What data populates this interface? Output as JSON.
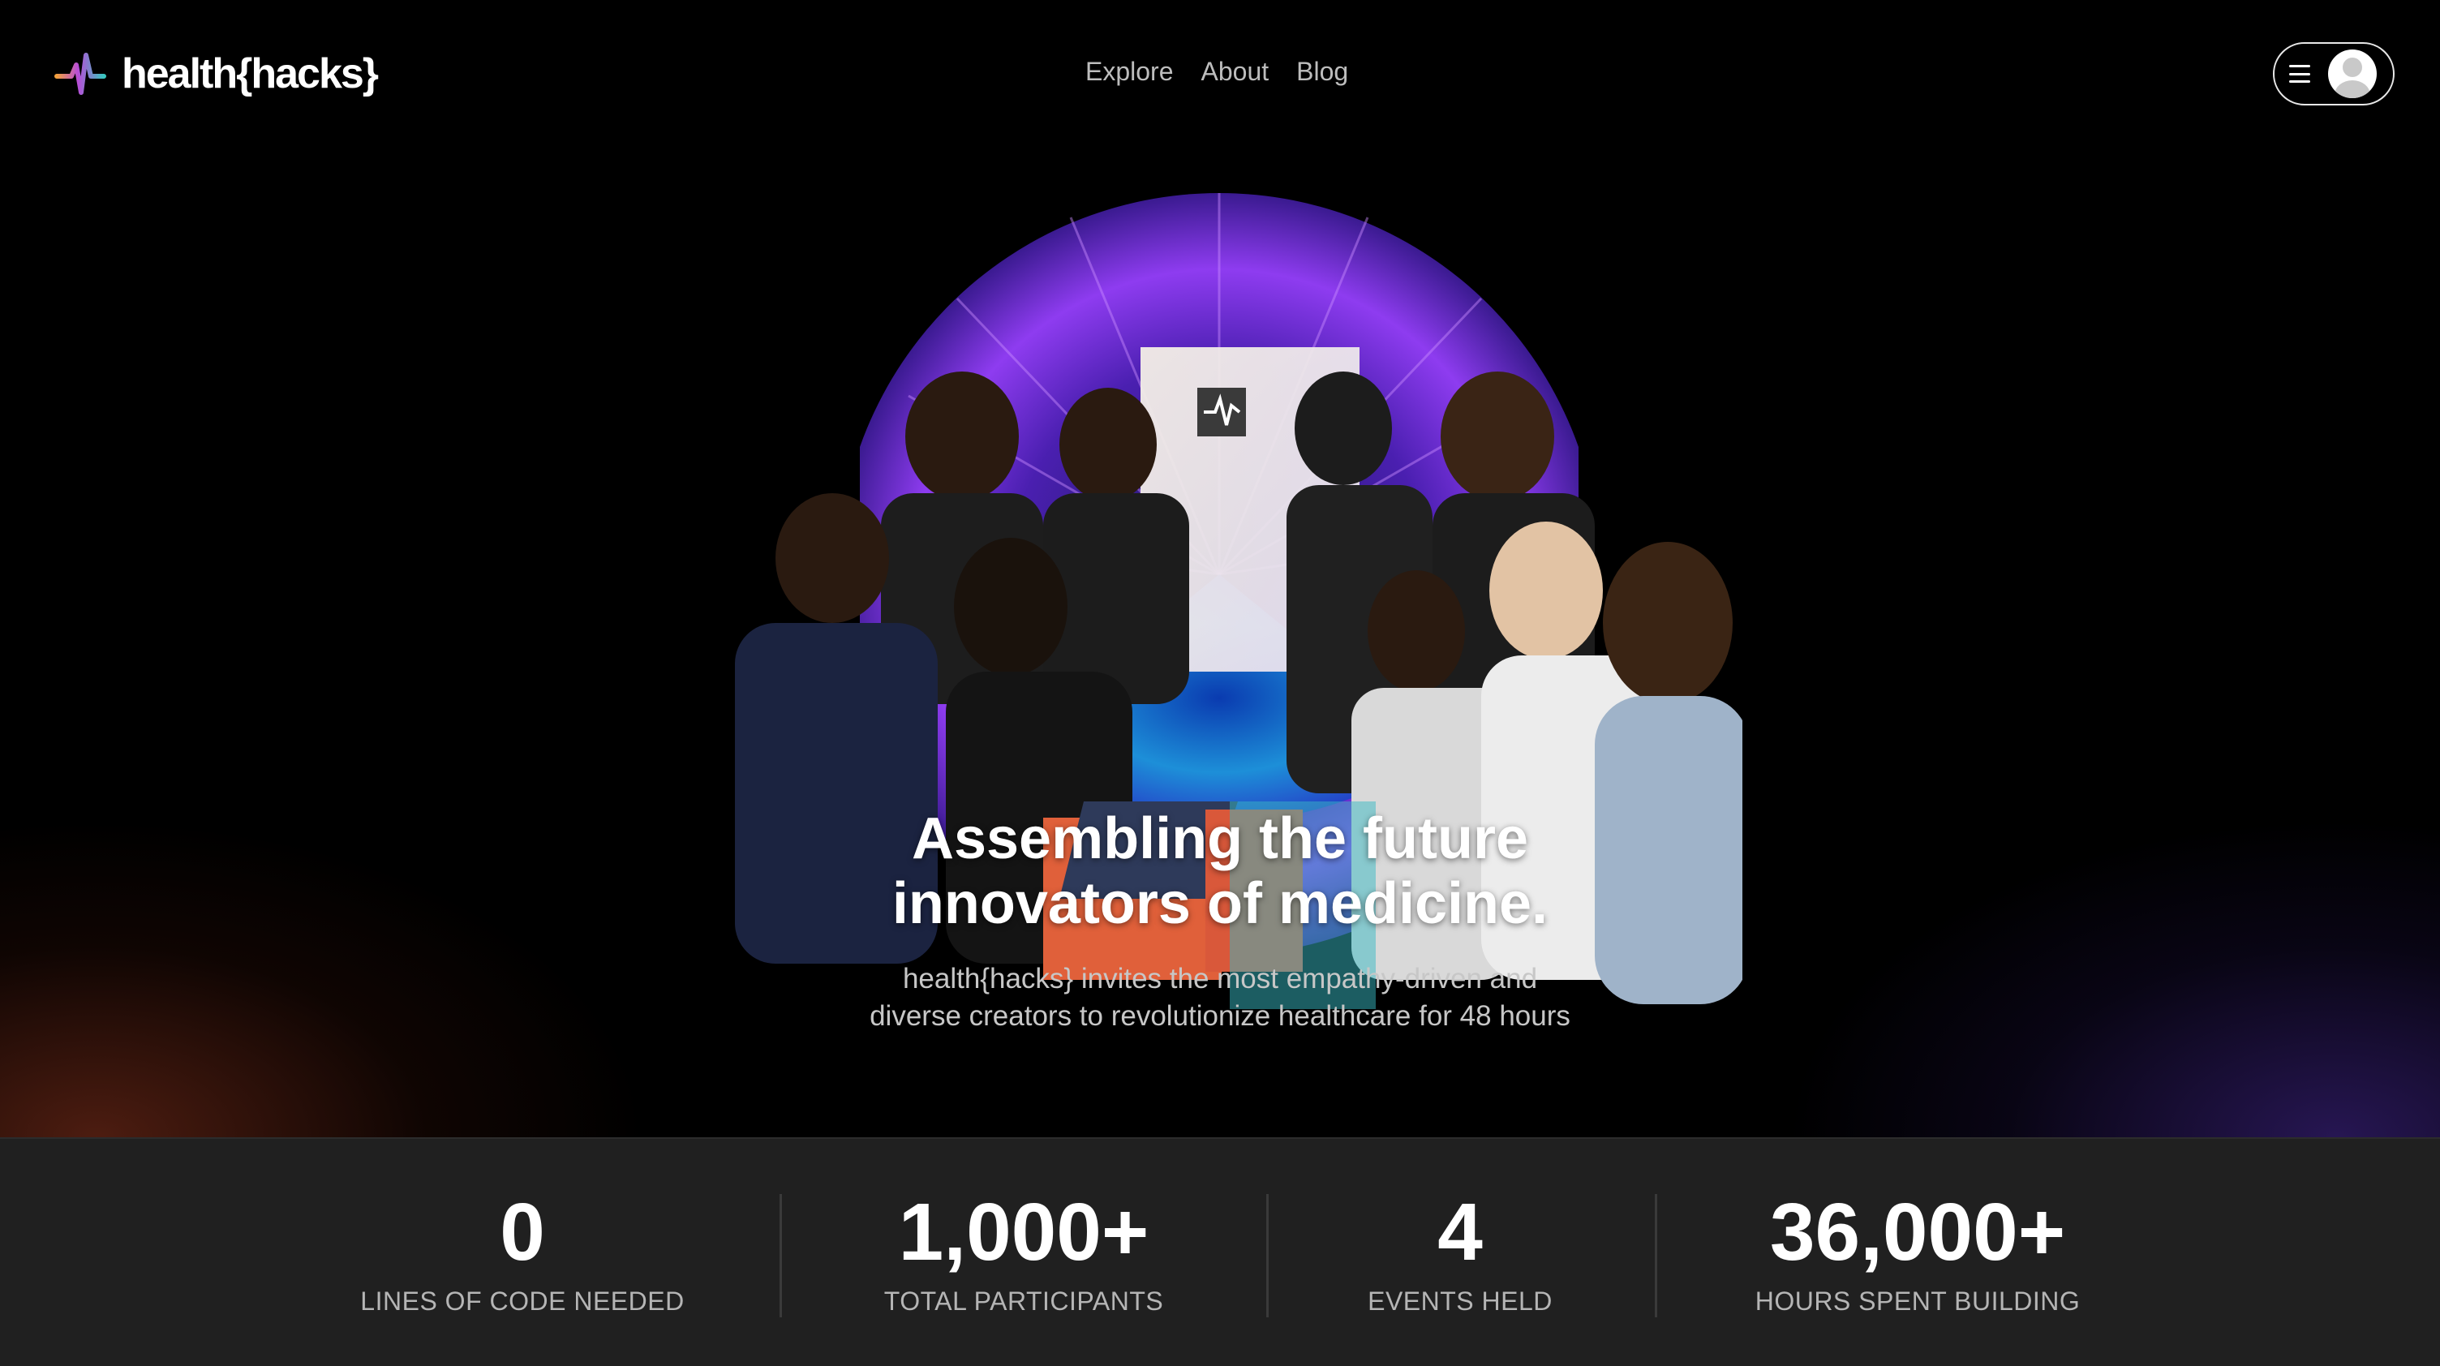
{
  "header": {
    "logo_text": "health{hacks}",
    "nav": [
      {
        "label": "Explore"
      },
      {
        "label": "About"
      },
      {
        "label": "Blog"
      }
    ],
    "menu_icon": "hamburger-icon",
    "avatar_icon": "user-avatar-icon"
  },
  "hero": {
    "headline_line1": "Assembling the future",
    "headline_line2": "innovators of medicine.",
    "subhead_line1": "health{hacks} invites the most empathy-driven and",
    "subhead_line2": "diverse creators to revolutionize healthcare for 48 hours",
    "image_description_icon": "team-photo-image"
  },
  "stats": [
    {
      "value": "0",
      "label": "LINES OF CODE NEEDED"
    },
    {
      "value": "1,000+",
      "label": "TOTAL PARTICIPANTS"
    },
    {
      "value": "4",
      "label": "EVENTS HELD"
    },
    {
      "value": "36,000+",
      "label": "HOURS SPENT BUILDING"
    }
  ],
  "colors": {
    "background": "#000000",
    "stats_background": "#202020",
    "nav_text": "#bdbdbd",
    "accent_purple": "#7b3fe4",
    "accent_orange": "#e86a2c",
    "accent_teal": "#3fc7c7"
  }
}
